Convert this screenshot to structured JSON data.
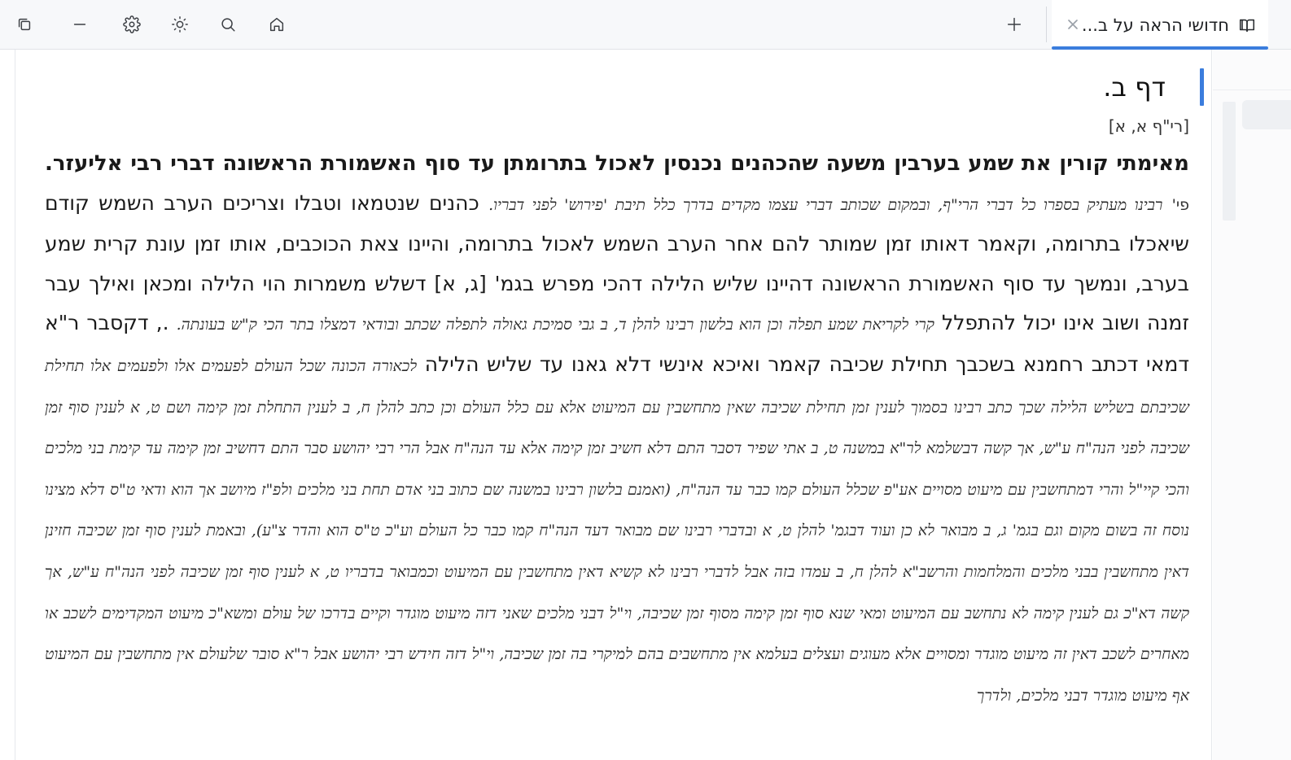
{
  "toolbar": {
    "icons": [
      "copy-window-icon",
      "minimize-icon",
      "settings-icon",
      "brightness-icon",
      "search-icon",
      "home-icon"
    ],
    "new_tab_icon": "plus-icon"
  },
  "tab": {
    "title": "חדושי הראה על ב...",
    "icon": "book-icon",
    "close_icon": "close-icon",
    "accent_color": "#3b7ddd"
  },
  "document": {
    "heading": "דף ב.",
    "reference": "[רי\"ף א, א]",
    "mishna_bold": "מאימתי קורין את שמע בערבין משעה שהכהנים נכנסין לאכול בתרומתן עד סוף האשמורת הראשונה דברי רבי אליעזר.",
    "pi": "פי'",
    "note_1": "רבינו מעתיק בספרו כל דברי הרי\"ף, ובמקום שכותב דברי עצמו מקדים בדרך כלל תיבת 'פירוש' לפני דבריו.",
    "text_1": "כהנים שנטמאו וטבלו וצריכים הערב השמש קודם שיאכלו בתרומה, וקאמר דאותו זמן שמותר להם אחר הערב השמש לאכול בתרומה, והיינו צאת הכוכבים, אותו זמן עונת קרית שמע בערב, ונמשך עד סוף האשמורת הראשונה דהיינו שליש הלילה דהכי מפרש בגמ' [ג, א] דשלש משמרות הוי הלילה ומכאן ואילך עבר זמנה ושוב אינו יכול להתפלל",
    "note_2": "קרי לקריאת שמע תפלה וכן הוא בלשון רבינו להלן ד, ב גבי סמיכת גאולה לתפלה שכתב ובודאי דמצלו בתר הכי ק\"ש בעונתה.",
    "text_2": "., דקסבר ר\"א דמאי דכתב רחמנא בשכבך תחילת שכיבה קאמר ואיכא אינשי דלא גאנו עד שליש הלילה",
    "note_3": "לכאורה הכונה שכל העולם לפעמים אלו ולפעמים אלו תחילת שכיבתם בשליש הלילה שכך כתב רבינו בסמוך לענין זמן תחילת שכיבה שאין מתחשבין עם המיעוט אלא עם כלל העולם וכן כתב להלן ח, ב לענין התחלת זמן קימה ושם ט, א לענין סוף זמן שכיבה לפני הנה\"ח ע\"ש, אך קשה דבשלמא לר\"א במשנה ט, ב אתי שפיר דסבר התם דלא חשיב זמן קימה אלא עד הנה\"ח אבל הרי רבי יהושע סבר התם דחשיב זמן קימה עד קימת בני מלכים והכי קיי\"ל והרי דמתחשבין עם מיעוט מסויים אע\"פ שכלל העולם קמו כבר עד הנה\"ח, (ואמנם בלשון רבינו במשנה שם כתוב בני אדם תחת בני מלכים ולפ\"ז מיושב אך הוא ודאי ט\"ס דלא מצינו נוסח זה בשום מקום וגם בגמ' ג, ב מבואר לא כן ועוד דבגמ' להלן ט, א ובדברי רבינו שם מבואר דעד הנה\"ח קמו כבר כל העולם וע\"כ ט\"ס הוא והדר צ\"ע), ובאמת לענין סוף זמן שכיבה חזינן דאין מתחשבין בבני מלכים והמלחמות והרשב\"א להלן ח, ב עמדו בזה אבל לדברי רבינו לא קשיא דאין מתחשבין עם המיעוט וכמבואר בדבריו ט, א לענין סוף זמן שכיבה לפני הנה\"ח ע\"ש, אך קשה דא\"כ גם לענין קימה לא נתחשב עם המיעוט ומאי שנא סוף זמן קימה מסוף זמן שכיבה, וי\"ל דבני מלכים שאני דזה מיעוט מוגדר וקיים בדרכו של עולם ומשא\"כ מיעוט המקדימים לשכב או מאחרים לשכב דאין זה מיעוט מוגדר ומסויים אלא מעוגים ועצלים בעלמא אין מתחשבים בהם למיקרי בה זמן שכיבה, וי\"ל דזה חידש רבי יהושע אבל ר\"א סובר שלעולם אין מתחשבין עם המיעוט אף מיעוט מוגדר דבני מלכים, ולדרך"
  }
}
